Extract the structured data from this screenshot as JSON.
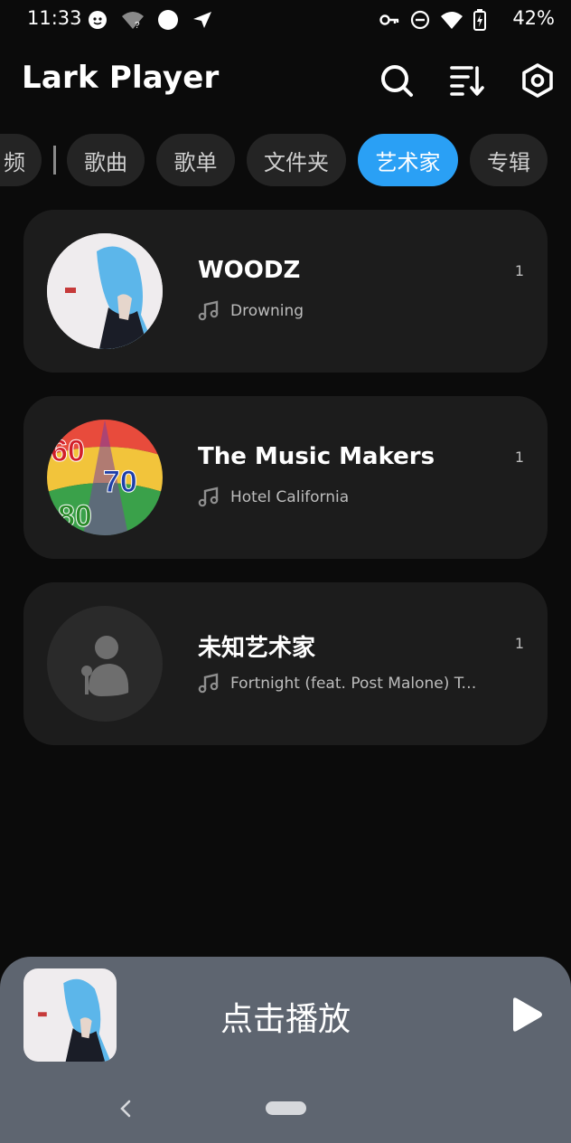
{
  "status_bar": {
    "time": "11:33",
    "battery": "42%",
    "left_icons": [
      "face-icon",
      "wifi-unknown-icon",
      "circle-icon",
      "send-icon"
    ],
    "right_icons": [
      "key-icon",
      "do-not-disturb-icon",
      "wifi-icon",
      "battery-icon"
    ]
  },
  "header": {
    "title": "Lark Player",
    "actions": [
      "search-icon",
      "sort-icon",
      "settings-icon"
    ]
  },
  "tabs": [
    {
      "label": "频",
      "active": false
    },
    {
      "label": "歌曲",
      "active": false
    },
    {
      "label": "歌单",
      "active": false
    },
    {
      "label": "文件夹",
      "active": false
    },
    {
      "label": "艺术家",
      "active": true
    },
    {
      "label": "专辑",
      "active": false
    }
  ],
  "artists": [
    {
      "name": "WOODZ",
      "song": "Drowning",
      "count": "1"
    },
    {
      "name": "The Music Makers",
      "song": "Hotel California",
      "count": "1"
    },
    {
      "name": "未知艺术家",
      "song": "Fortnight (feat. Post Malone) Tayl...",
      "count": "1"
    }
  ],
  "mini_player": {
    "title": "点击播放"
  },
  "colors": {
    "background": "#0b0b0b",
    "card": "#1c1c1c",
    "accent": "#2aa0f5",
    "mini_player": "#5e6570"
  }
}
